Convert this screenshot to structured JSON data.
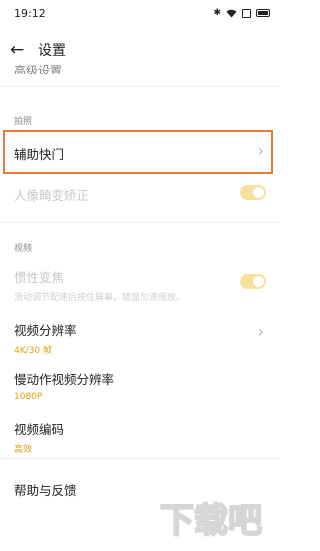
{
  "status_bar": {
    "time": "19:12",
    "icons": [
      "bluetooth-icon",
      "wifi-icon",
      "sim-icon",
      "battery-icon"
    ]
  },
  "header": {
    "title": "设置",
    "back_icon": "back-arrow-icon"
  },
  "scrolled_item": {
    "label": "高级设置"
  },
  "sections": {
    "photo": {
      "title": "拍照"
    },
    "video": {
      "title": "视频"
    }
  },
  "items": {
    "assist_shutter": {
      "label": "辅助快门"
    },
    "portrait_distortion": {
      "label": "人像畸变矫正",
      "toggle_on": true,
      "enabled": false
    },
    "inertial_zoom": {
      "label": "惯性变焦",
      "description": "滑动调节配速后按住屏幕，镜面匀速缩放。",
      "toggle_on": true,
      "enabled": false
    },
    "video_resolution": {
      "label": "视频分辨率",
      "value": "4K/30 帧"
    },
    "slowmo_resolution": {
      "label": "慢动作视频分辨率",
      "value": "1080P"
    },
    "video_encoding": {
      "label": "视频编码",
      "value": "高效"
    },
    "help_feedback": {
      "label": "帮助与反馈"
    }
  },
  "colors": {
    "accent": "#e0a112",
    "toggle_disabled": "#f7df9c",
    "highlight": "#e97b3a"
  },
  "watermark": {
    "text": "下载吧"
  }
}
